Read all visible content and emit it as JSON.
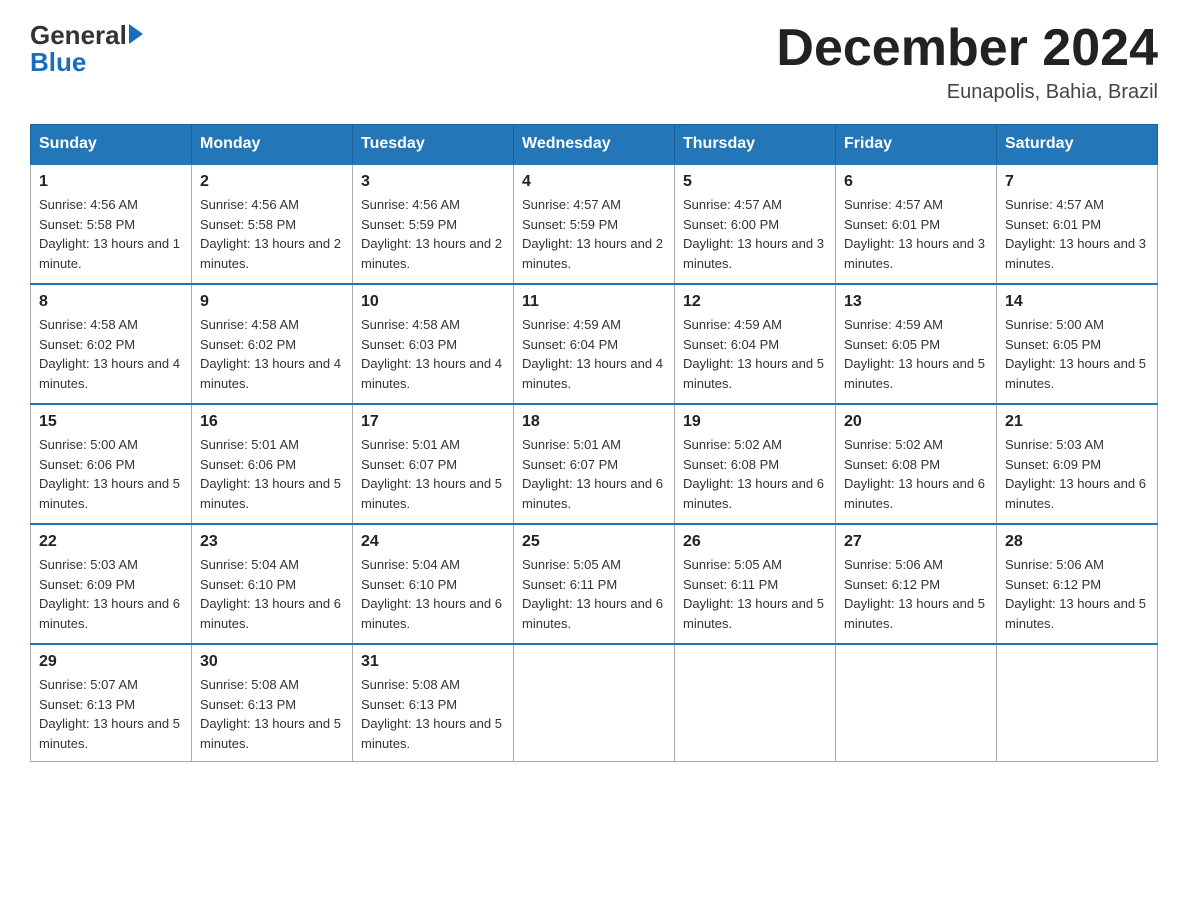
{
  "logo": {
    "general": "General",
    "triangle": "▶",
    "blue": "Blue"
  },
  "header": {
    "title": "December 2024",
    "subtitle": "Eunapolis, Bahia, Brazil"
  },
  "days_of_week": [
    "Sunday",
    "Monday",
    "Tuesday",
    "Wednesday",
    "Thursday",
    "Friday",
    "Saturday"
  ],
  "weeks": [
    [
      {
        "day": "1",
        "sunrise": "4:56 AM",
        "sunset": "5:58 PM",
        "daylight": "13 hours and 1 minute."
      },
      {
        "day": "2",
        "sunrise": "4:56 AM",
        "sunset": "5:58 PM",
        "daylight": "13 hours and 2 minutes."
      },
      {
        "day": "3",
        "sunrise": "4:56 AM",
        "sunset": "5:59 PM",
        "daylight": "13 hours and 2 minutes."
      },
      {
        "day": "4",
        "sunrise": "4:57 AM",
        "sunset": "5:59 PM",
        "daylight": "13 hours and 2 minutes."
      },
      {
        "day": "5",
        "sunrise": "4:57 AM",
        "sunset": "6:00 PM",
        "daylight": "13 hours and 3 minutes."
      },
      {
        "day": "6",
        "sunrise": "4:57 AM",
        "sunset": "6:01 PM",
        "daylight": "13 hours and 3 minutes."
      },
      {
        "day": "7",
        "sunrise": "4:57 AM",
        "sunset": "6:01 PM",
        "daylight": "13 hours and 3 minutes."
      }
    ],
    [
      {
        "day": "8",
        "sunrise": "4:58 AM",
        "sunset": "6:02 PM",
        "daylight": "13 hours and 4 minutes."
      },
      {
        "day": "9",
        "sunrise": "4:58 AM",
        "sunset": "6:02 PM",
        "daylight": "13 hours and 4 minutes."
      },
      {
        "day": "10",
        "sunrise": "4:58 AM",
        "sunset": "6:03 PM",
        "daylight": "13 hours and 4 minutes."
      },
      {
        "day": "11",
        "sunrise": "4:59 AM",
        "sunset": "6:04 PM",
        "daylight": "13 hours and 4 minutes."
      },
      {
        "day": "12",
        "sunrise": "4:59 AM",
        "sunset": "6:04 PM",
        "daylight": "13 hours and 5 minutes."
      },
      {
        "day": "13",
        "sunrise": "4:59 AM",
        "sunset": "6:05 PM",
        "daylight": "13 hours and 5 minutes."
      },
      {
        "day": "14",
        "sunrise": "5:00 AM",
        "sunset": "6:05 PM",
        "daylight": "13 hours and 5 minutes."
      }
    ],
    [
      {
        "day": "15",
        "sunrise": "5:00 AM",
        "sunset": "6:06 PM",
        "daylight": "13 hours and 5 minutes."
      },
      {
        "day": "16",
        "sunrise": "5:01 AM",
        "sunset": "6:06 PM",
        "daylight": "13 hours and 5 minutes."
      },
      {
        "day": "17",
        "sunrise": "5:01 AM",
        "sunset": "6:07 PM",
        "daylight": "13 hours and 5 minutes."
      },
      {
        "day": "18",
        "sunrise": "5:01 AM",
        "sunset": "6:07 PM",
        "daylight": "13 hours and 6 minutes."
      },
      {
        "day": "19",
        "sunrise": "5:02 AM",
        "sunset": "6:08 PM",
        "daylight": "13 hours and 6 minutes."
      },
      {
        "day": "20",
        "sunrise": "5:02 AM",
        "sunset": "6:08 PM",
        "daylight": "13 hours and 6 minutes."
      },
      {
        "day": "21",
        "sunrise": "5:03 AM",
        "sunset": "6:09 PM",
        "daylight": "13 hours and 6 minutes."
      }
    ],
    [
      {
        "day": "22",
        "sunrise": "5:03 AM",
        "sunset": "6:09 PM",
        "daylight": "13 hours and 6 minutes."
      },
      {
        "day": "23",
        "sunrise": "5:04 AM",
        "sunset": "6:10 PM",
        "daylight": "13 hours and 6 minutes."
      },
      {
        "day": "24",
        "sunrise": "5:04 AM",
        "sunset": "6:10 PM",
        "daylight": "13 hours and 6 minutes."
      },
      {
        "day": "25",
        "sunrise": "5:05 AM",
        "sunset": "6:11 PM",
        "daylight": "13 hours and 6 minutes."
      },
      {
        "day": "26",
        "sunrise": "5:05 AM",
        "sunset": "6:11 PM",
        "daylight": "13 hours and 5 minutes."
      },
      {
        "day": "27",
        "sunrise": "5:06 AM",
        "sunset": "6:12 PM",
        "daylight": "13 hours and 5 minutes."
      },
      {
        "day": "28",
        "sunrise": "5:06 AM",
        "sunset": "6:12 PM",
        "daylight": "13 hours and 5 minutes."
      }
    ],
    [
      {
        "day": "29",
        "sunrise": "5:07 AM",
        "sunset": "6:13 PM",
        "daylight": "13 hours and 5 minutes."
      },
      {
        "day": "30",
        "sunrise": "5:08 AM",
        "sunset": "6:13 PM",
        "daylight": "13 hours and 5 minutes."
      },
      {
        "day": "31",
        "sunrise": "5:08 AM",
        "sunset": "6:13 PM",
        "daylight": "13 hours and 5 minutes."
      },
      null,
      null,
      null,
      null
    ]
  ]
}
